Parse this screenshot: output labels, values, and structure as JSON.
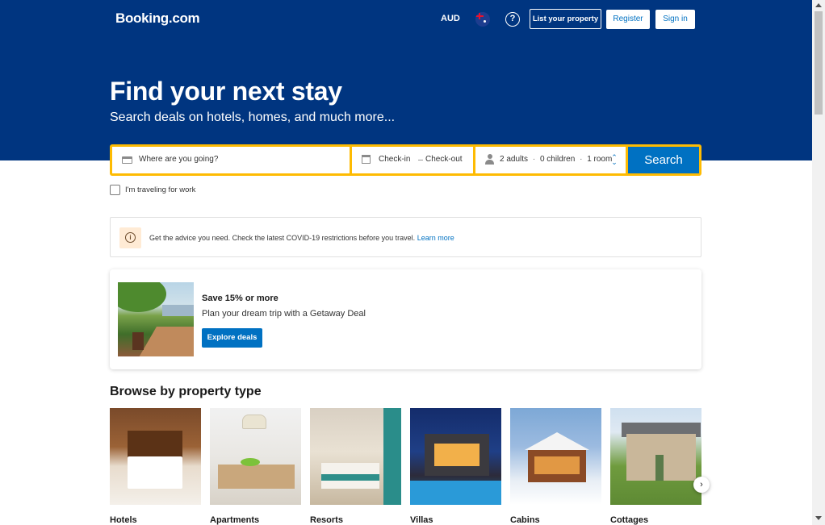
{
  "header": {
    "logo": "Booking.com",
    "currency": "AUD",
    "flag_icon": "australia-flag-icon",
    "help_icon": "help-icon",
    "list_property": "List your property",
    "register": "Register",
    "sign_in": "Sign in",
    "background_color": "#003580"
  },
  "hero": {
    "title": "Find your next stay",
    "subtitle": "Search deals on hotels, homes, and much more..."
  },
  "search": {
    "destination_placeholder": "Where are you going?",
    "check_in": "Check-in",
    "check_out": "Check-out",
    "adults": "2 adults",
    "children": "0 children",
    "rooms": "1 room",
    "separator": "·",
    "search_button": "Search",
    "work_travel": "I'm traveling for work",
    "accent_color": "#febb02",
    "button_color": "#0071c2"
  },
  "banner": {
    "text": "Get the advice you need. Check the latest COVID-19 restrictions before you travel.",
    "link": "Learn more"
  },
  "deal": {
    "title": "Save 15% or more",
    "subtitle": "Plan your dream trip with a Getaway Deal",
    "button": "Explore deals"
  },
  "browse": {
    "title": "Browse by property type",
    "types": [
      {
        "label": "Hotels"
      },
      {
        "label": "Apartments"
      },
      {
        "label": "Resorts"
      },
      {
        "label": "Villas"
      },
      {
        "label": "Cabins"
      },
      {
        "label": "Cottages"
      }
    ],
    "next_icon": "chevron-right-icon"
  }
}
